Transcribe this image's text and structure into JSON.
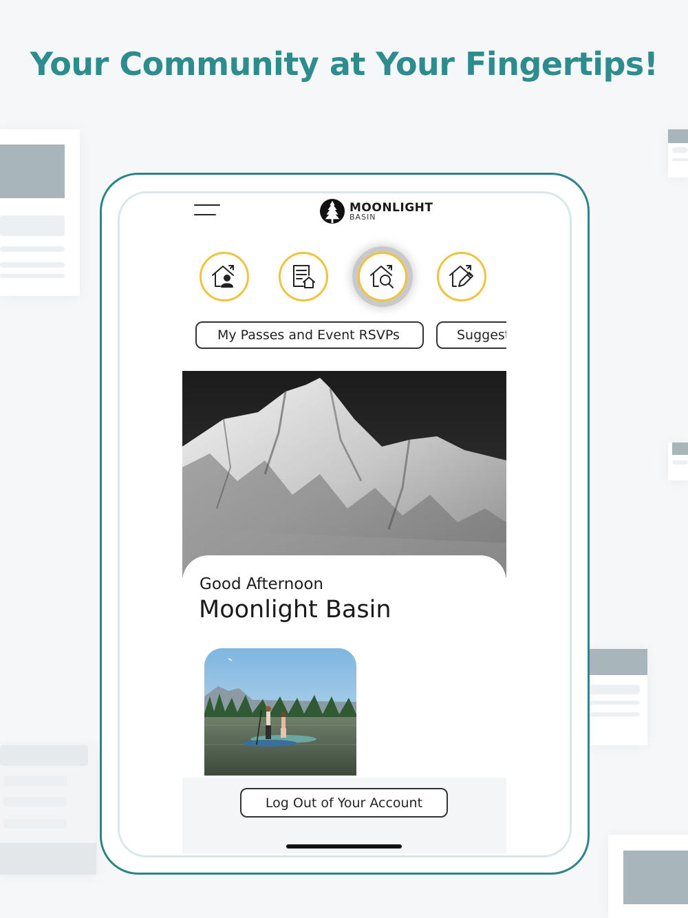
{
  "headline": "Your Community at Your Fingertips!",
  "app": {
    "logo_title": "MOONLIGHT",
    "logo_subtitle": "BASIN",
    "quick_actions": [
      {
        "icon": "home-person-icon"
      },
      {
        "icon": "document-home-icon"
      },
      {
        "icon": "home-search-icon",
        "selected": true
      },
      {
        "icon": "home-edit-icon"
      }
    ],
    "tabs": [
      {
        "label": "My Passes and Event RSVPs"
      },
      {
        "label": "Suggest"
      }
    ],
    "greeting": "Good Afternoon",
    "community_name": "Moonlight Basin",
    "logout_label": "Log Out of Your Account"
  },
  "colors": {
    "accent": "#2c8c8e",
    "device_border": "#2c8388",
    "icon_ring": "#f0c23e",
    "background": "#f6f7f8"
  }
}
